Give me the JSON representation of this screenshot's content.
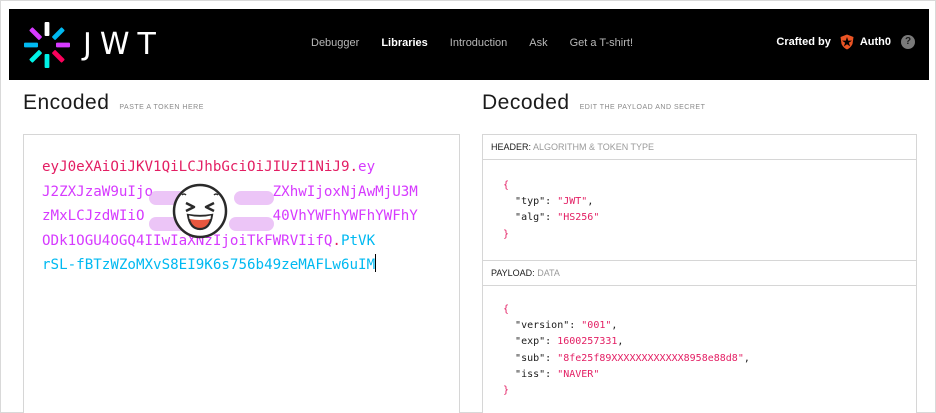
{
  "navbar": {
    "wordmark": "JWT",
    "links": [
      "Debugger",
      "Libraries",
      "Introduction",
      "Ask",
      "Get a T-shirt!"
    ],
    "active_link": "Libraries",
    "crafted_by": "Crafted by",
    "brand": "Auth0",
    "help": "?"
  },
  "encoded": {
    "title": "Encoded",
    "subtitle": "PASTE A TOKEN HERE",
    "token_lines": [
      {
        "parts": [
          {
            "t": "eyJ0eXAiOiJKV1QiLCJhbGciOiJIUzI1NiJ9",
            "c": "red"
          },
          {
            "t": ".",
            "c": "red"
          },
          {
            "t": "ey",
            "c": "purple"
          }
        ]
      },
      {
        "parts": [
          {
            "t": "J2ZXJzaW9uIjo",
            "c": "purple"
          },
          {
            "t": "              ",
            "c": "purple"
          },
          {
            "t": "ZXhwIjoxNjAwMjU3M",
            "c": "purple"
          }
        ]
      },
      {
        "parts": [
          {
            "t": "zMxLCJzdWIiO",
            "c": "purple"
          },
          {
            "t": "               ",
            "c": "purple"
          },
          {
            "t": "40VhYWFhYWFhYWFhY",
            "c": "purple"
          }
        ]
      },
      {
        "parts": [
          {
            "t": "ODk1OGU4OGQ4I",
            "c": "purple"
          },
          {
            "t": "IwIaXNzIjoiTkFWRVIifQ",
            "c": "purple"
          },
          {
            "t": ".",
            "c": "red"
          },
          {
            "t": "PtVK",
            "c": "blue"
          }
        ]
      },
      {
        "parts": [
          {
            "t": "rSL-fBTzWZoMXvS8EI9K6s756b49zeMAFLw6uIM",
            "c": "blue"
          }
        ]
      }
    ]
  },
  "decoded": {
    "title": "Decoded",
    "subtitle": "EDIT THE PAYLOAD AND SECRET",
    "header_label": "HEADER:",
    "header_sublabel": "ALGORITHM & TOKEN TYPE",
    "header_json": [
      {
        "key": "typ",
        "value": "JWT",
        "type": "string"
      },
      {
        "key": "alg",
        "value": "HS256",
        "type": "string"
      }
    ],
    "payload_label": "PAYLOAD:",
    "payload_sublabel": "DATA",
    "payload_json": [
      {
        "key": "version",
        "value": "001",
        "type": "string"
      },
      {
        "key": "exp",
        "value": "1600257331",
        "type": "number"
      },
      {
        "key": "sub",
        "value": "8fe25f89XXXXXXXXXXXX8958e88d8",
        "type": "string"
      },
      {
        "key": "iss",
        "value": "NAVER",
        "type": "string"
      }
    ]
  },
  "colors": {
    "header": "#e31e63",
    "payload": "#d63aff",
    "signature": "#00b9f1"
  },
  "icons": [
    "jwt-logo-icon",
    "auth0-shield-icon",
    "help-icon",
    "laughing-face-sticker-icon"
  ]
}
